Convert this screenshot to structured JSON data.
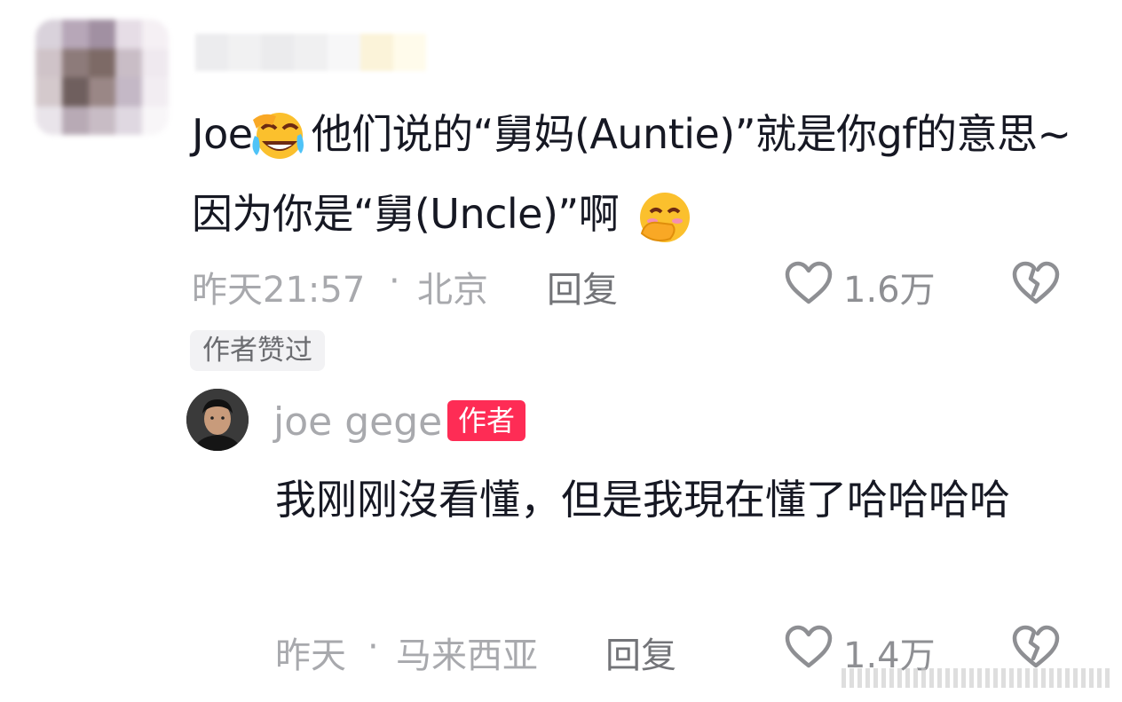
{
  "comment": {
    "text_prefix": "Joe",
    "text_main": " 他们说的“舅妈(Auntie)”就是你gf的意思~因为你是“舅(Uncle)”啊 ",
    "timestamp": "昨天21:57",
    "separator": "·",
    "location": "北京",
    "reply_label": "回复",
    "like_count": "1.6万",
    "author_liked_badge": "作者赞过"
  },
  "reply": {
    "username": "joe gege",
    "author_badge": "作者",
    "text": "我刚刚沒看懂，但是我現在懂了哈哈哈哈",
    "timestamp": "昨天",
    "separator": "·",
    "location": "马来西亚",
    "reply_label": "回复",
    "like_count": "1.4万"
  },
  "colors": {
    "accent": "#fe2c55",
    "text": "#161823",
    "meta": "#a8a9ad",
    "badge_bg": "#f2f2f4"
  },
  "icons": {
    "like": "heart-outline-icon",
    "dislike": "broken-heart-icon",
    "emoji1": "rolling-laughing-emoji",
    "emoji2": "hand-over-mouth-emoji"
  }
}
